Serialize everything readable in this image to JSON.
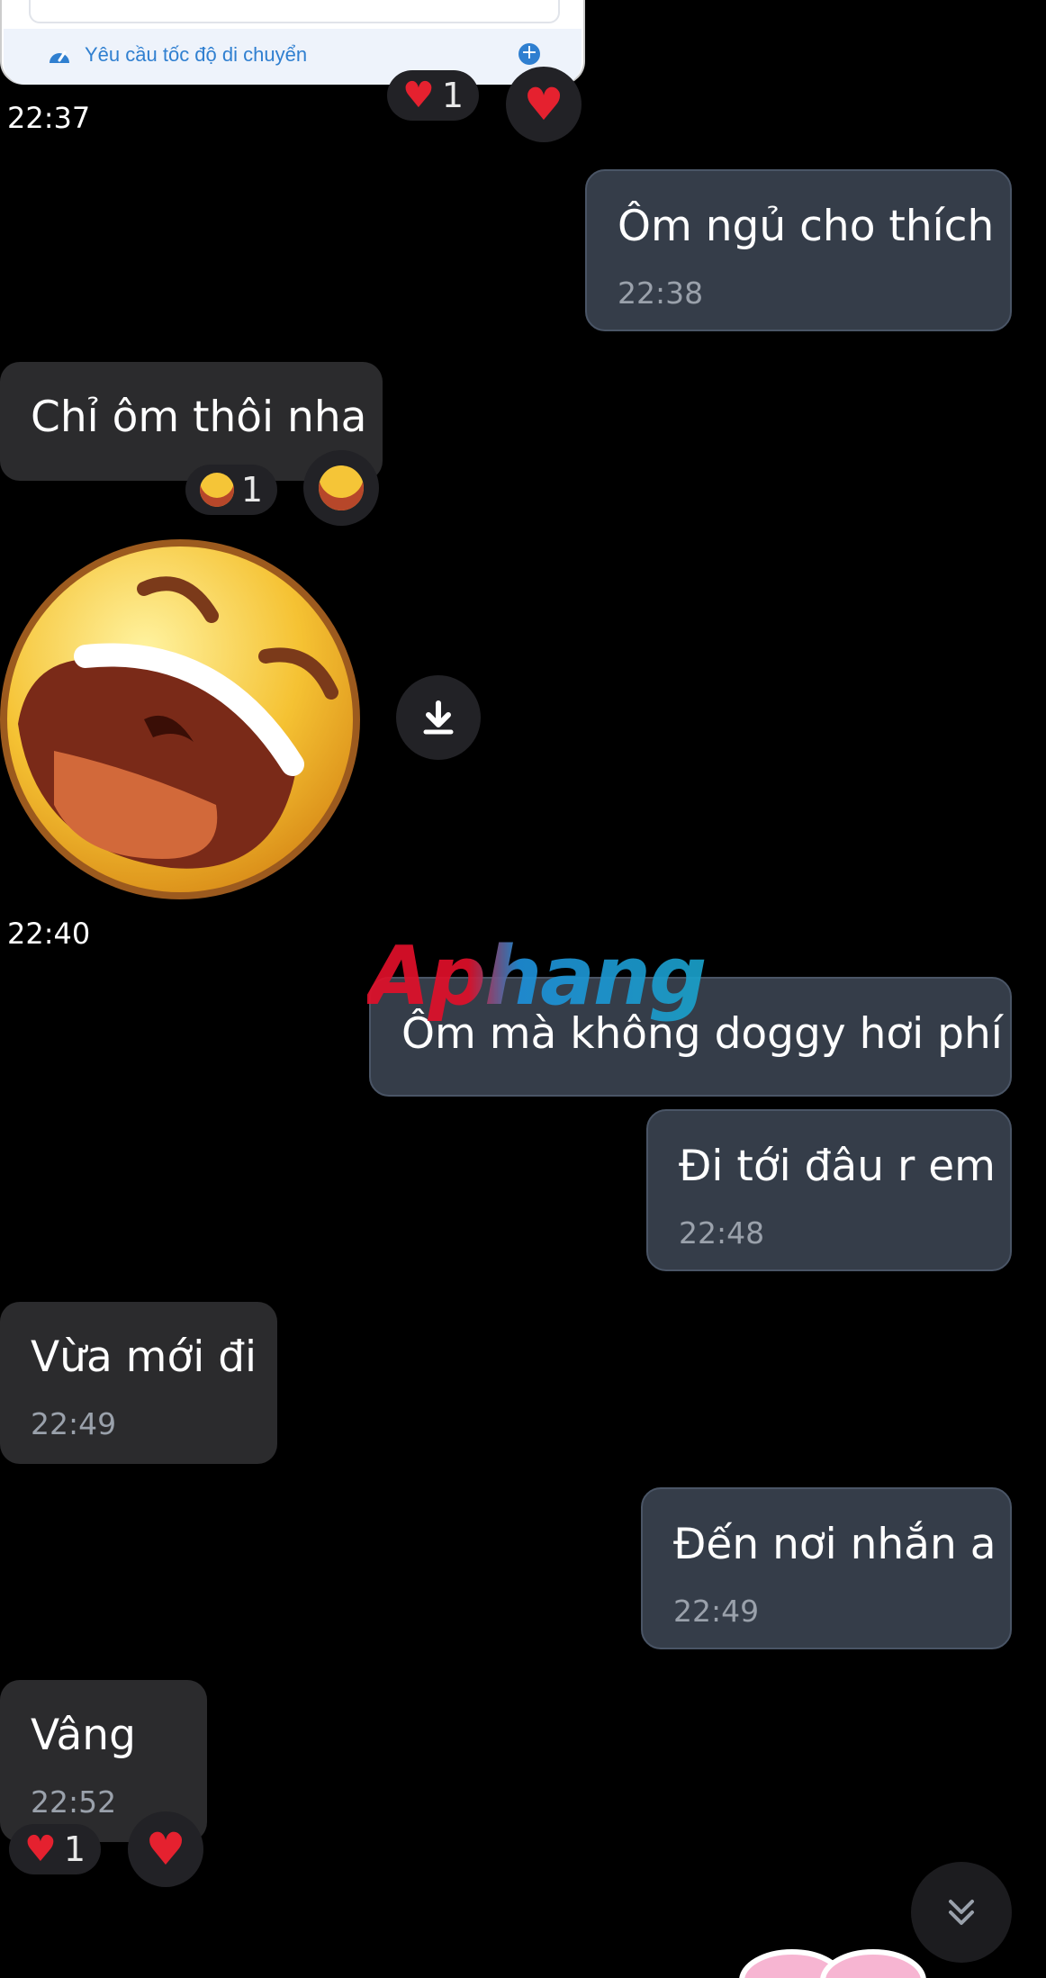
{
  "shared_card": {
    "action_label": "Yêu cầu tốc độ di chuyển",
    "time": "22:37",
    "reaction_count": "1",
    "reaction_icon": "heart-icon"
  },
  "messages": [
    {
      "id": "m1",
      "side": "sent",
      "text": "Ôm ngủ cho thích",
      "time": "22:38"
    },
    {
      "id": "m2",
      "side": "received",
      "text": "Chỉ ôm thôi nha",
      "reaction_count": "1",
      "reaction_icon": "laughing-face-icon"
    },
    {
      "id": "m3",
      "side": "received",
      "type": "sticker",
      "sticker": "laughing-face-sticker",
      "time": "22:40"
    },
    {
      "id": "m4",
      "side": "sent",
      "text": "Ôm mà không doggy hơi phí"
    },
    {
      "id": "m5",
      "side": "sent",
      "text": "Đi tới đâu r em",
      "time": "22:48"
    },
    {
      "id": "m6",
      "side": "received",
      "text": "Vừa mới đi",
      "time": "22:49"
    },
    {
      "id": "m7",
      "side": "sent",
      "text": "Đến nơi nhắn a",
      "time": "22:49"
    },
    {
      "id": "m8",
      "side": "received",
      "text": "Vâng",
      "time": "22:52",
      "reaction_count": "1",
      "reaction_icon": "heart-icon"
    }
  ],
  "watermark": "Aphang",
  "colors": {
    "background": "#000000",
    "received_bubble": "#2b2b2d",
    "sent_bubble": "#353d49",
    "heart": "#e5212f",
    "link_blue": "#2f7fd0"
  }
}
